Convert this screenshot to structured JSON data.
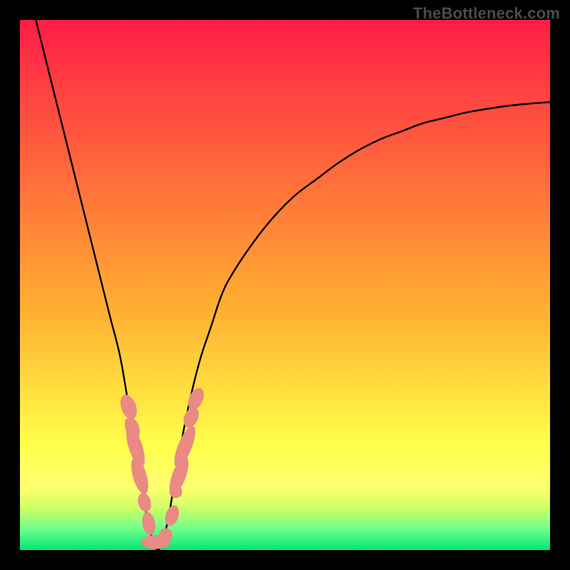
{
  "watermark": "TheBottleneck.com",
  "background_top_color": "#ff1d47",
  "background_mid_color": "#ffff4a",
  "background_green1": "#cfff66",
  "background_green2": "#6fff8a",
  "background_bottom": "#00e67a",
  "curve_color": "#000000",
  "marker_fill": "#e98a84",
  "marker_stroke": "#d46a62",
  "chart_data": {
    "type": "line",
    "title": "",
    "xlabel": "",
    "ylabel": "",
    "xlim": [
      0,
      100
    ],
    "ylim": [
      0,
      100
    ],
    "grid": false,
    "series": [
      {
        "name": "bottleneck-curve",
        "x": [
          3,
          5,
          7,
          9,
          11,
          13,
          15,
          17,
          19,
          21,
          22,
          23,
          24,
          25,
          26,
          27,
          28,
          29,
          30,
          32,
          34,
          36,
          38,
          40,
          44,
          48,
          52,
          56,
          60,
          64,
          68,
          72,
          76,
          80,
          84,
          88,
          92,
          96,
          100
        ],
        "y": [
          100,
          92,
          84,
          76,
          68,
          60,
          52,
          44,
          36,
          24,
          18,
          12,
          6,
          2,
          0,
          2,
          6,
          12,
          18,
          28,
          36,
          42,
          48,
          52,
          58,
          63,
          67,
          70,
          73,
          75.5,
          77.5,
          79,
          80.5,
          81.5,
          82.5,
          83.2,
          83.8,
          84.2,
          84.5
        ]
      }
    ],
    "markers": [
      {
        "cx": 20.5,
        "cy": 27,
        "rx": 1.4,
        "ry": 2.4,
        "rot": -20
      },
      {
        "cx": 21.2,
        "cy": 23,
        "rx": 1.3,
        "ry": 2.2,
        "rot": -20
      },
      {
        "cx": 21.8,
        "cy": 19.5,
        "rx": 1.3,
        "ry": 4.0,
        "rot": -18
      },
      {
        "cx": 22.6,
        "cy": 14.0,
        "rx": 1.3,
        "ry": 3.6,
        "rot": -16
      },
      {
        "cx": 23.5,
        "cy": 9.0,
        "rx": 1.2,
        "ry": 1.8,
        "rot": -14
      },
      {
        "cx": 24.3,
        "cy": 5.0,
        "rx": 1.2,
        "ry": 2.2,
        "rot": -10
      },
      {
        "cx": 25.6,
        "cy": 1.5,
        "rx": 2.8,
        "ry": 1.3,
        "rot": 0
      },
      {
        "cx": 27.5,
        "cy": 2.8,
        "rx": 1.3,
        "ry": 1.3,
        "rot": 0
      },
      {
        "cx": 28.7,
        "cy": 6.5,
        "rx": 1.2,
        "ry": 2.0,
        "rot": 18
      },
      {
        "cx": 29.4,
        "cy": 11.0,
        "rx": 1.2,
        "ry": 1.2,
        "rot": 0
      },
      {
        "cx": 30.0,
        "cy": 14.0,
        "rx": 1.3,
        "ry": 3.8,
        "rot": 20
      },
      {
        "cx": 31.1,
        "cy": 19.5,
        "rx": 1.3,
        "ry": 4.2,
        "rot": 22
      },
      {
        "cx": 32.3,
        "cy": 25.0,
        "rx": 1.3,
        "ry": 2.0,
        "rot": 24
      },
      {
        "cx": 33.2,
        "cy": 28.5,
        "rx": 1.3,
        "ry": 2.2,
        "rot": 24
      }
    ]
  }
}
